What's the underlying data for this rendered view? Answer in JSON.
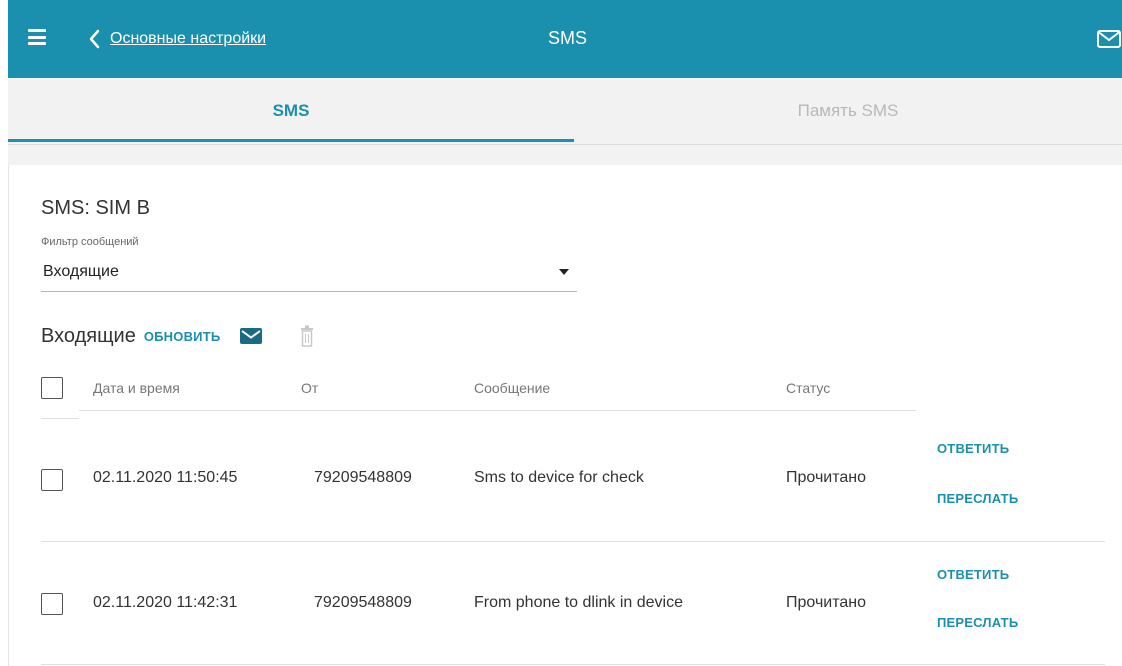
{
  "header": {
    "back_label": "Основные настройки",
    "title": "SMS",
    "menu_icon": "hamburger-icon",
    "mail_icon": "envelope-icon",
    "background": "#1a8fae"
  },
  "tabs": [
    {
      "label": "SMS",
      "active": true
    },
    {
      "label": "Память SMS",
      "active": false
    }
  ],
  "card": {
    "title": "SMS: SIM B",
    "filter": {
      "label": "Фильтр сообщений",
      "value": "Входящие"
    }
  },
  "section": {
    "title": "Входящие",
    "refresh_label": "ОБНОВИТЬ",
    "new_icon": "envelope-icon",
    "delete_icon": "trash-icon"
  },
  "table": {
    "columns": [
      "Дата и время",
      "От",
      "Сообщение",
      "Статус"
    ],
    "rows": [
      {
        "date": "02.11.2020 11:50:45",
        "from": "79209548809",
        "message": "Sms to device for check",
        "status": "Прочитано",
        "reply": "ОТВЕТИТЬ",
        "forward": "ПЕРЕСЛАТЬ"
      },
      {
        "date": "02.11.2020 11:42:31",
        "from": "79209548809",
        "message": "From phone to dlink in device",
        "status": "Прочитано",
        "reply": "ОТВЕТИТЬ",
        "forward": "ПЕРЕСЛАТЬ"
      }
    ]
  },
  "colors": {
    "accent": "#1a8fae",
    "inactive_tab": "#b8b8b8"
  }
}
